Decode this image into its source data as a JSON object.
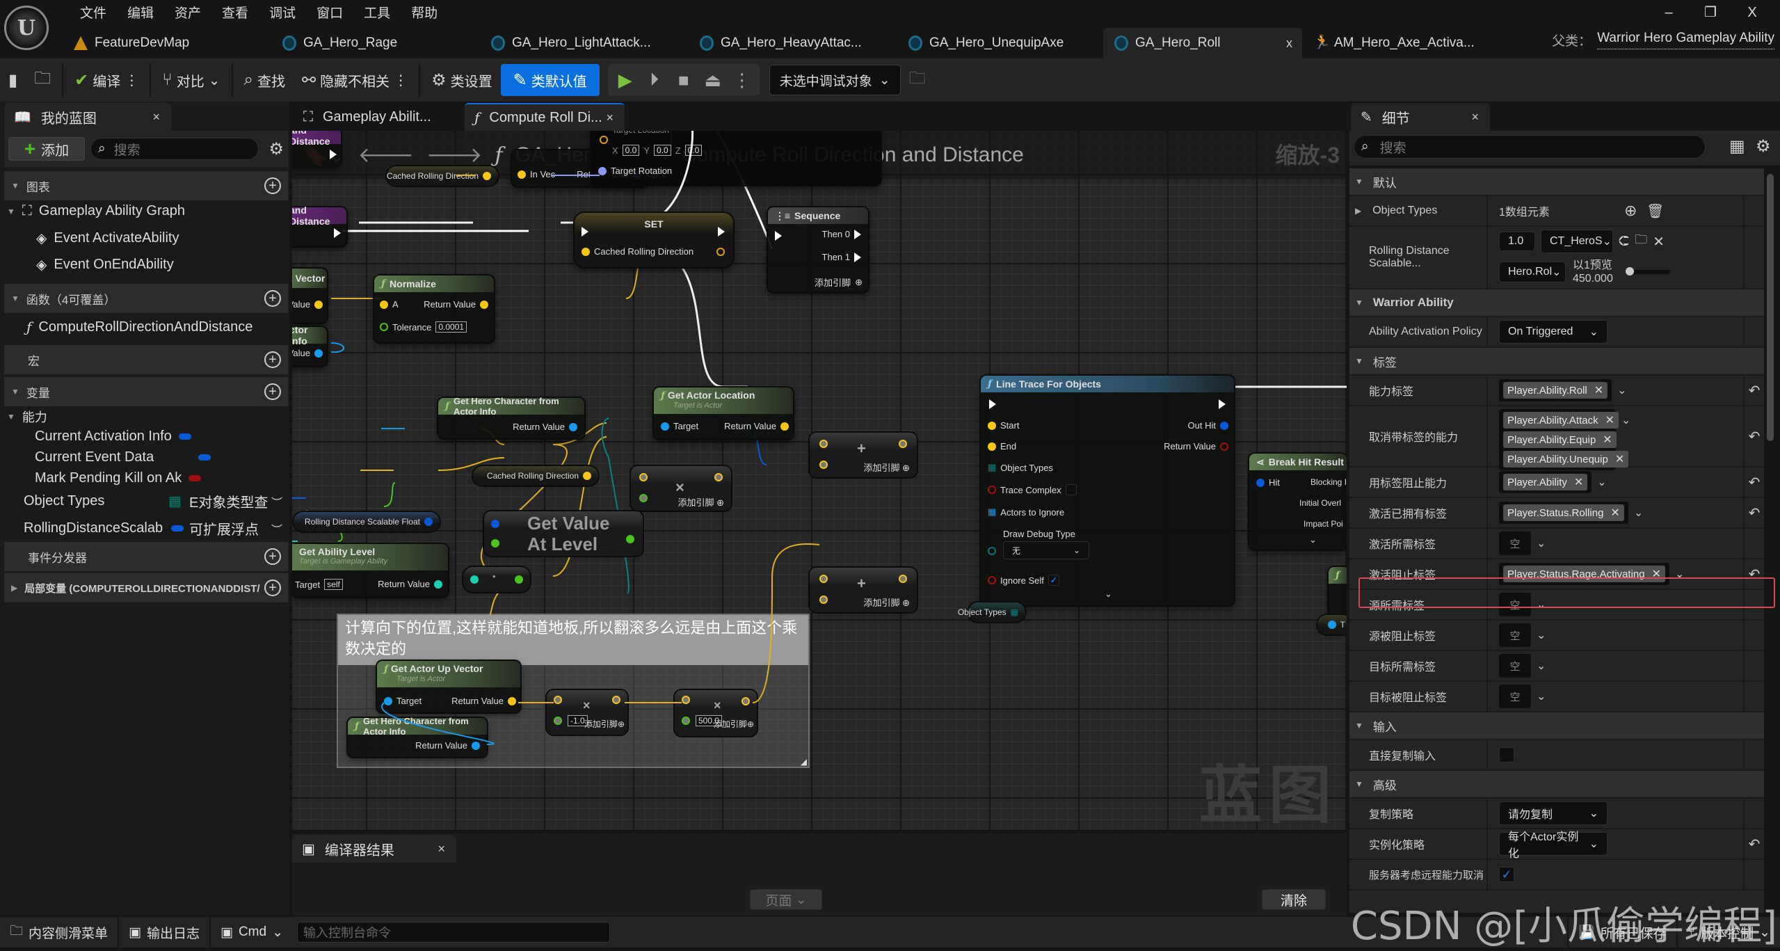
{
  "app": {
    "logo": "U"
  },
  "menu": [
    "文件",
    "编辑",
    "资产",
    "查看",
    "调试",
    "窗口",
    "工具",
    "帮助"
  ],
  "window_controls": {
    "minimize": "–",
    "restore": "❐",
    "close": "X"
  },
  "doc_tabs": [
    {
      "label": "FeatureDevMap",
      "icon": "map-icon",
      "active": false
    },
    {
      "label": "GA_Hero_Rage",
      "icon": "blueprint-icon",
      "active": false
    },
    {
      "label": "GA_Hero_LightAttack...",
      "icon": "blueprint-icon",
      "active": false
    },
    {
      "label": "GA_Hero_HeavyAttac...",
      "icon": "blueprint-icon",
      "active": false
    },
    {
      "label": "GA_Hero_UnequipAxe",
      "icon": "blueprint-icon",
      "active": false
    },
    {
      "label": "GA_Hero_Roll",
      "icon": "blueprint-icon",
      "active": true,
      "close": "x"
    },
    {
      "label": "AM_Hero_Axe_Activa...",
      "icon": "anim-montage-icon",
      "active": false
    }
  ],
  "parent_class": {
    "label": "父类：",
    "value": "Warrior Hero Gameplay Ability"
  },
  "toolbar": {
    "compile": "编译",
    "diff": "对比",
    "find": "查找",
    "hide_unrelated": "隐藏不相关",
    "class_settings": "类设置",
    "class_defaults": "类默认值",
    "debug_target": "未选中调试对象"
  },
  "my_blueprint": {
    "tab": "我的蓝图",
    "close": "×",
    "add": "添加",
    "search_placeholder": "搜索",
    "sections": {
      "graphs": "图表",
      "functions": "函数（4可覆盖）",
      "macros": "宏",
      "variables": "变量",
      "dispatchers": "事件分发器",
      "locals": "局部变量 (COMPUTEROLLDIRECTIONANDDIST/"
    },
    "graph_items": {
      "graph": "Gameplay Ability Graph",
      "events": [
        "Event ActivateAbility",
        "Event OnEndAbility"
      ]
    },
    "function_items": [
      "ComputeRollDirectionAndDistance"
    ],
    "variable_category": "能力",
    "variables": [
      {
        "name": "Current Activation Info",
        "color": "#0a5ad8"
      },
      {
        "name": "Current Event Data",
        "color": "#0a5ad8"
      },
      {
        "name": "Mark Pending Kill on Ak",
        "color": "#a01010"
      }
    ],
    "members": [
      {
        "name": "Object Types",
        "type": "E对象类型查",
        "color": "#0b7a6a"
      },
      {
        "name": "RollingDistanceScalab",
        "type": "可扩展浮点",
        "color": "#0a5ad8"
      }
    ]
  },
  "graph": {
    "tabs": [
      {
        "label": "Gameplay Abilit..."
      },
      {
        "label": "Compute Roll Di...",
        "close": "×"
      }
    ],
    "breadcrumb": {
      "root": "GA_Hero_Roll",
      "current": "Compute Roll Direction and Distance"
    },
    "zoom": "缩放-3",
    "watermark": "蓝图",
    "nodes": {
      "entry": {
        "title": "and Distance"
      },
      "set": {
        "title": "SET",
        "pin": "Cached Rolling Direction"
      },
      "sequence": {
        "title": "Sequence",
        "pins": [
          "Then 0",
          "Then 1"
        ],
        "add_pin": "添加引脚"
      },
      "normalize": {
        "title": "Normalize",
        "in": "A",
        "out": "Return Value",
        "tolerance_label": "Tolerance",
        "tolerance": "0.0001"
      },
      "vector_partial": {
        "title": "t Vector",
        "out": "urn Value"
      },
      "actorinfo_partial": {
        "title": "ctor Info",
        "out": "urn Value"
      },
      "cached_top": {
        "label": "Cached Rolling Direction"
      },
      "rot_from_vec": {
        "in": "In Vec",
        "out": "Return Value"
      },
      "rot_target": {
        "loc_label": "Target Location",
        "x": "0.0",
        "y": "0.0",
        "z": "0.0",
        "rot_label": "Target Rotation"
      },
      "get_hero": {
        "title": "Get Hero Character from Actor Info",
        "out": "Return Value"
      },
      "get_loc": {
        "title": "Get Actor Location",
        "sub": "Target is Actor",
        "in": "Target",
        "out": "Return Value"
      },
      "cached_mid": {
        "label": "Cached Rolling Direction"
      },
      "mul1": {
        "sym": "×",
        "add_pin": "添加引脚"
      },
      "add1": {
        "sym": "+",
        "add_pin": "添加引脚"
      },
      "add2": {
        "sym": "+",
        "add_pin": "添加引脚"
      },
      "rolling_var": {
        "label": "Rolling Distance Scalable Float"
      },
      "get_value": {
        "title": "Get Value At Level"
      },
      "ability_level": {
        "title": "Get Ability Level",
        "sub": "Target is Gameplay Ability",
        "in": "Target",
        "self": "self",
        "out": "Return Value"
      },
      "conv": {
        "sym": "•"
      },
      "trace": {
        "title": "Line Trace For Objects",
        "pins_in": [
          "Start",
          "End",
          "Object Types",
          "Trace Complex",
          "Actors to Ignore",
          "Draw Debug Type",
          "Ignore Self"
        ],
        "pins_out": [
          "Out Hit",
          "Return Value"
        ],
        "debug_value": "无",
        "ignore_self": true,
        "trace_complex": false
      },
      "obj_types": {
        "label": "Object Types"
      },
      "break_hit": {
        "title": "Break Hit Result",
        "in": "Hit",
        "outs": [
          "Blocking I",
          "Initial Overl",
          "Impact Poi"
        ]
      },
      "comment": {
        "text": "计算向下的位置,这样就能知道地板,所以翻滚多么远是由上面这个乘数决定的"
      },
      "up_vec": {
        "title": "Get Actor Up Vector",
        "sub": "Target is Actor",
        "in": "Target",
        "out": "Return Value"
      },
      "get_hero2": {
        "title": "Get Hero Character from Actor Info",
        "out": "Return Value"
      },
      "mul2": {
        "sym": "×",
        "value": "-1.0",
        "add_pin": "添加引脚"
      },
      "mul3": {
        "sym": "×",
        "value": "500.0",
        "add_pin": "添加引脚"
      },
      "edge_t": {
        "label": "T"
      }
    }
  },
  "compiler": {
    "tab": "编译器结果",
    "close": "×",
    "page": "页面",
    "clear": "清除"
  },
  "details": {
    "tab": "细节",
    "close": "×",
    "search_placeholder": "搜索",
    "sections": [
      {
        "title": "默认",
        "rows": [
          {
            "label": "Object Types",
            "type": "array",
            "value": "1数组元素"
          },
          {
            "label": "Rolling Distance Scalable...",
            "type": "scalable",
            "value": "1.0",
            "curve_table": "CT_HeroS",
            "row": "Hero.Rol",
            "preview_label": "以1预览",
            "preview_value": "450.000"
          }
        ]
      },
      {
        "title": "Warrior Ability",
        "bold": true,
        "rows": [
          {
            "label": "Ability Activation Policy",
            "type": "combo",
            "value": "On Triggered"
          }
        ]
      },
      {
        "title": "标签",
        "rows": [
          {
            "label": "能力标签",
            "type": "tags",
            "tags": [
              "Player.Ability.Roll"
            ],
            "reset": true
          },
          {
            "label": "取消带标签的能力",
            "type": "tags",
            "tags": [
              "Player.Ability.Attack",
              "Player.Ability.Equip",
              "Player.Ability.Unequip"
            ],
            "reset": true
          },
          {
            "label": "用标签阻止能力",
            "type": "tags",
            "tags": [
              "Player.Ability"
            ],
            "reset": true
          },
          {
            "label": "激活已拥有标签",
            "type": "tags",
            "tags": [
              "Player.Status.Rolling"
            ],
            "reset": true
          },
          {
            "label": "激活所需标签",
            "type": "empty",
            "value": "空"
          },
          {
            "label": "激活阻止标签",
            "type": "tags",
            "tags": [
              "Player.Status.Rage.Activating"
            ],
            "reset": true,
            "highlighted": true
          },
          {
            "label": "源所需标签",
            "type": "empty",
            "value": "空"
          },
          {
            "label": "源被阻止标签",
            "type": "empty",
            "value": "空"
          },
          {
            "label": "目标所需标签",
            "type": "empty",
            "value": "空"
          },
          {
            "label": "目标被阻止标签",
            "type": "empty",
            "value": "空"
          }
        ]
      },
      {
        "title": "输入",
        "rows": [
          {
            "label": "直接复制输入",
            "type": "check",
            "checked": false
          }
        ]
      },
      {
        "title": "高级",
        "rows": [
          {
            "label": "复制策略",
            "type": "combo",
            "value": "请勿复制"
          },
          {
            "label": "实例化策略",
            "type": "combo",
            "value": "每个Actor实例化",
            "reset": true
          },
          {
            "label": "服务器考虑远程能力取消",
            "type": "check",
            "checked": true
          }
        ]
      }
    ]
  },
  "statusbar": {
    "content_drawer": "内容侧滑菜单",
    "output_log": "输出日志",
    "cmd": "Cmd",
    "console_placeholder": "输入控制台命令",
    "saved": "所有已保存",
    "source_control": "版本控制"
  },
  "watermark_csdn": "CSDN @[小瓜偷学编程]"
}
